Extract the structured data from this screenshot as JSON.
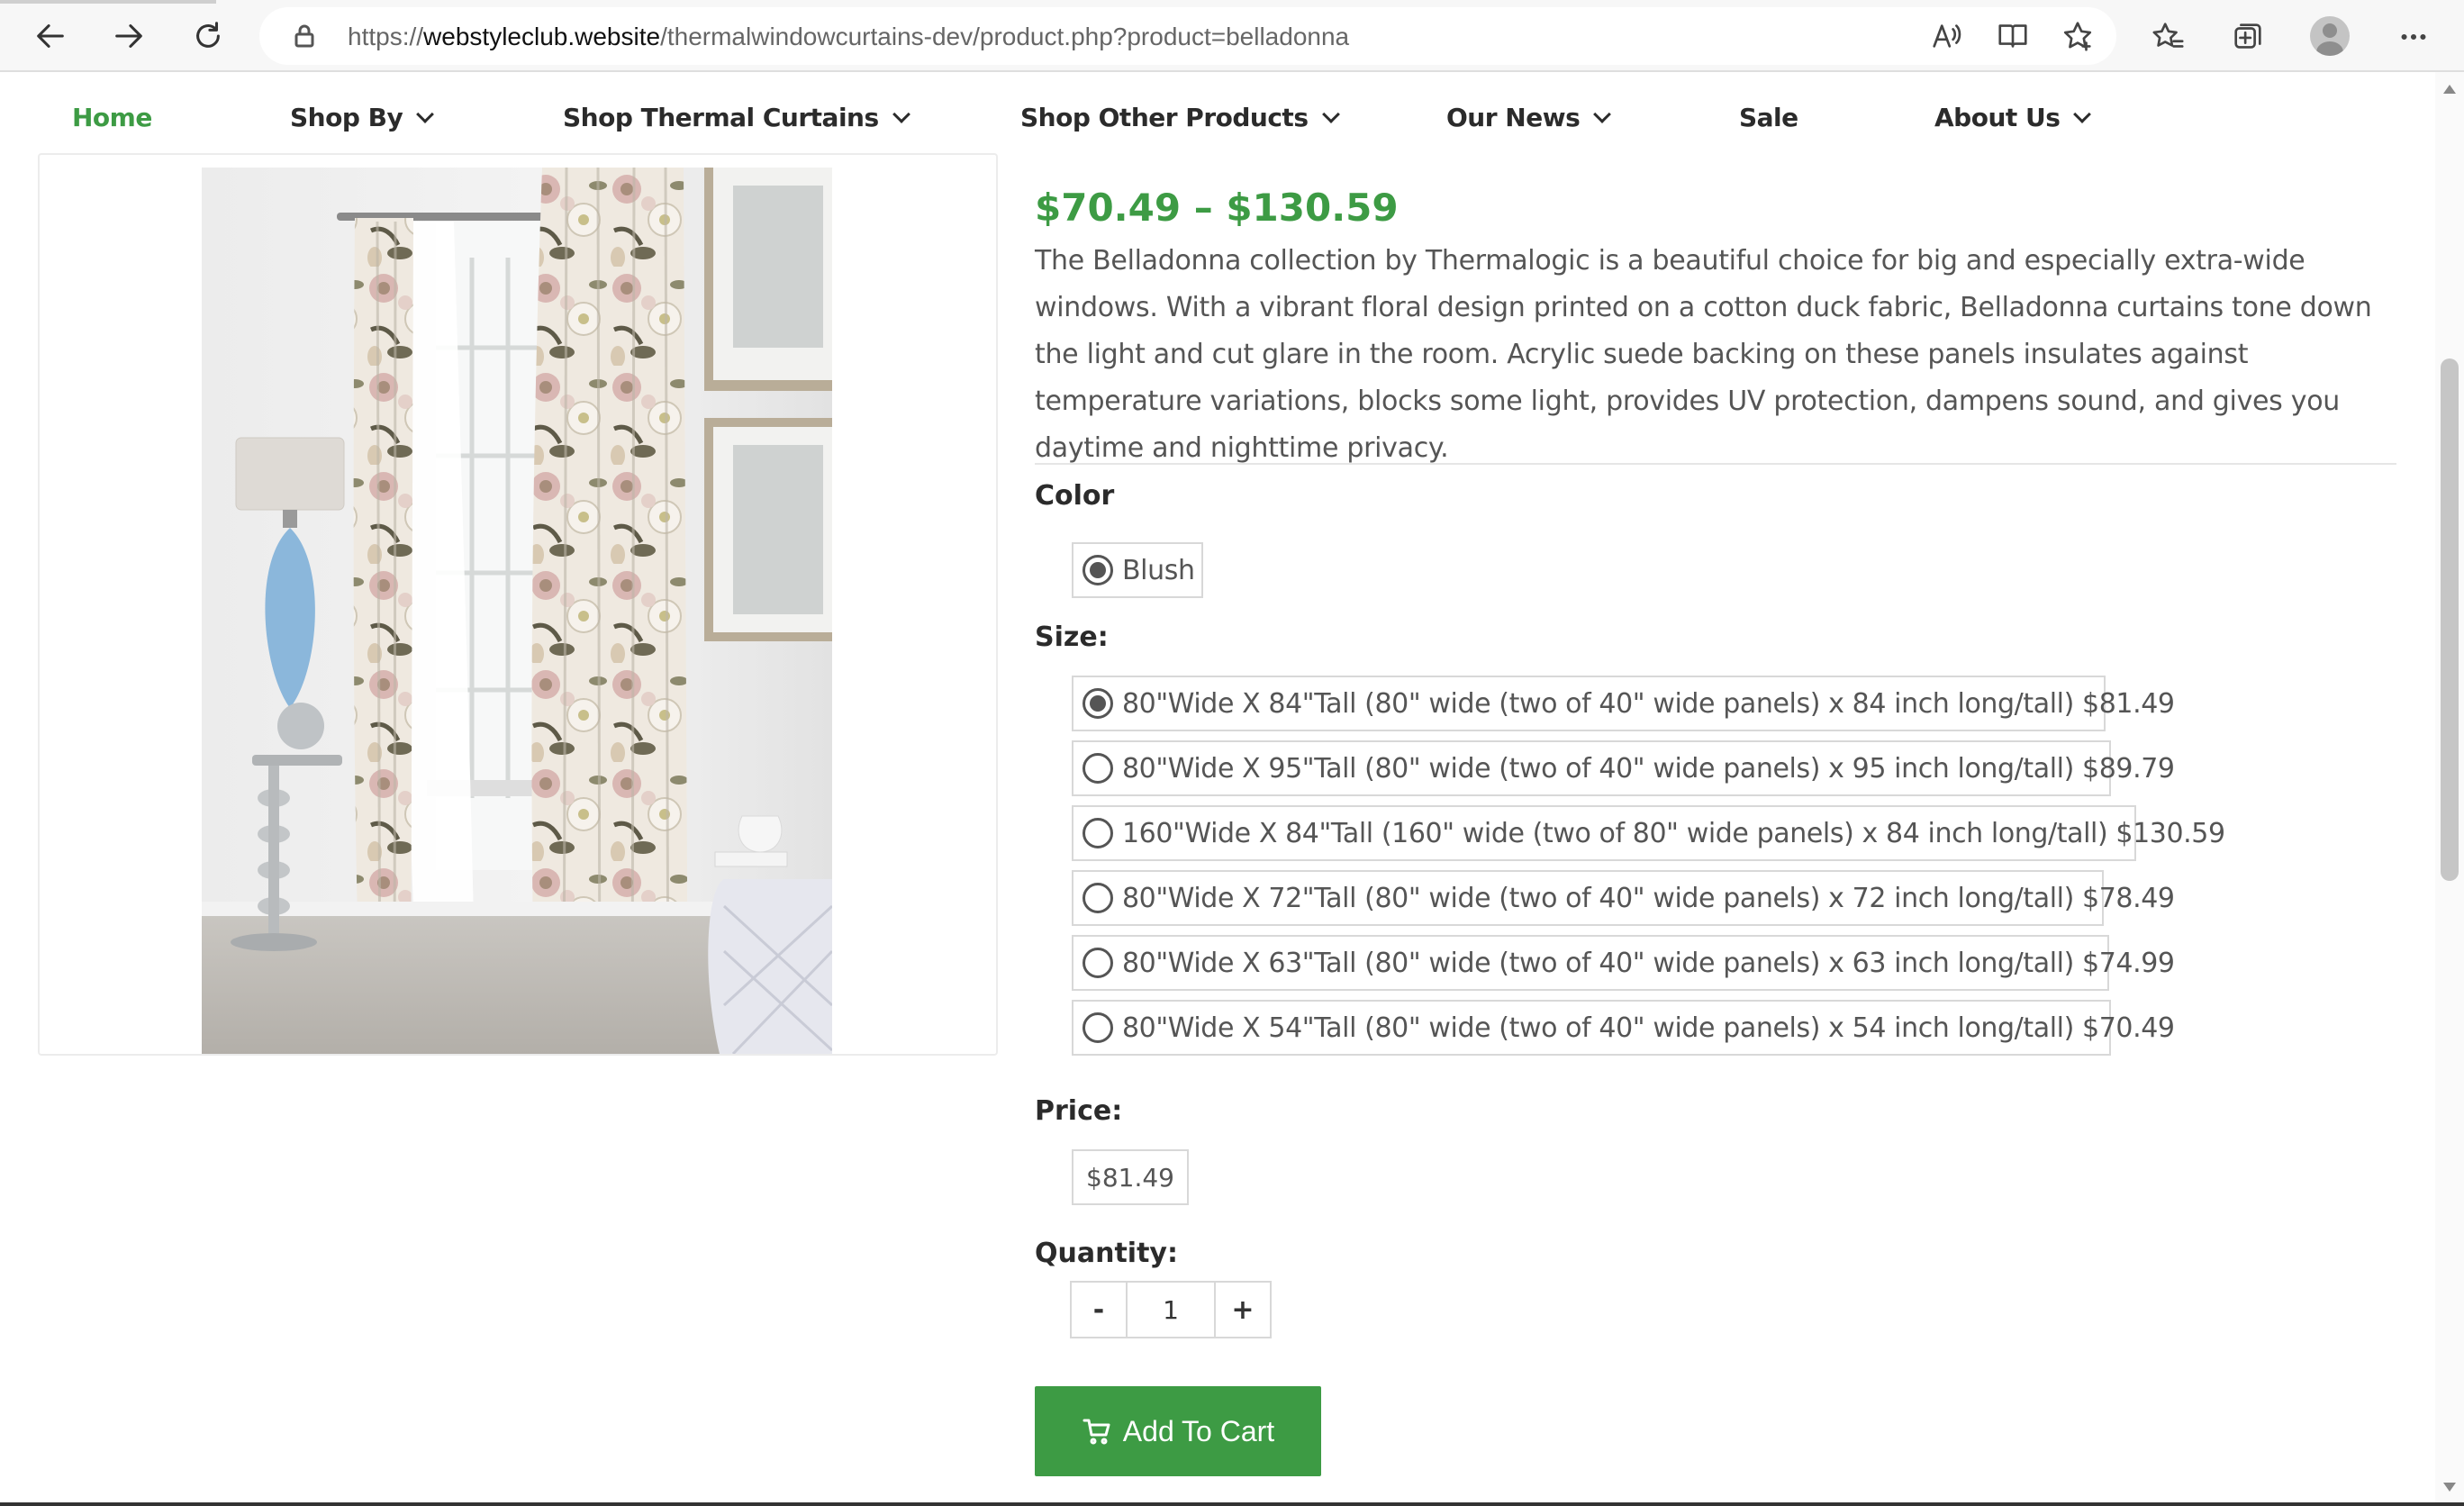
{
  "browser": {
    "url_prefix": "https://",
    "url_host": "webstyleclub.website",
    "url_path": "/thermalwindowcurtains-dev/product.php?product=belladonna"
  },
  "nav": {
    "items": [
      {
        "label": "Home",
        "active": true,
        "dropdown": false
      },
      {
        "label": "Shop By",
        "dropdown": true
      },
      {
        "label": "Shop Thermal Curtains",
        "dropdown": true
      },
      {
        "label": "Shop Other Products",
        "dropdown": true
      },
      {
        "label": "Our News",
        "dropdown": true
      },
      {
        "label": "Sale",
        "dropdown": false
      },
      {
        "label": "About Us",
        "dropdown": true
      }
    ]
  },
  "product": {
    "price_range": "$70.49 – $130.59",
    "description": "The Belladonna collection by Thermalogic is a beautiful choice for big and especially extra-wide windows. With a vibrant floral design printed on a cotton duck fabric, Belladonna curtains tone down the light and cut glare in the room. Acrylic suede backing on these panels insulates against temperature variations, blocks some light, provides UV protection, dampens sound, and gives you daytime and nighttime privacy.",
    "color_label": "Color",
    "color_options": [
      {
        "label": "Blush",
        "selected": true
      }
    ],
    "size_label": "Size:",
    "size_options": [
      {
        "label": "80\"Wide X 84\"Tall (80\" wide (two of 40\" wide panels) x 84 inch long/tall) $81.49",
        "selected": true
      },
      {
        "label": "80\"Wide X 95\"Tall (80\" wide (two of 40\" wide panels) x 95 inch long/tall) $89.79",
        "selected": false
      },
      {
        "label": "160\"Wide X 84\"Tall (160\" wide (two of 80\" wide panels) x 84 inch long/tall) $130.59",
        "selected": false
      },
      {
        "label": "80\"Wide X 72\"Tall (80\" wide (two of 40\" wide panels) x 72 inch long/tall) $78.49",
        "selected": false
      },
      {
        "label": "80\"Wide X 63\"Tall (80\" wide (two of 40\" wide panels) x 63 inch long/tall) $74.99",
        "selected": false
      },
      {
        "label": "80\"Wide X 54\"Tall (80\" wide (two of 40\" wide panels) x 54 inch long/tall) $70.49",
        "selected": false
      }
    ],
    "price_label": "Price:",
    "price_value": "$81.49",
    "quantity_label": "Quantity:",
    "quantity_minus": "-",
    "quantity_value": "1",
    "quantity_plus": "+",
    "add_to_cart": "Add To Cart"
  },
  "colors": {
    "accent": "#3d9b44"
  }
}
